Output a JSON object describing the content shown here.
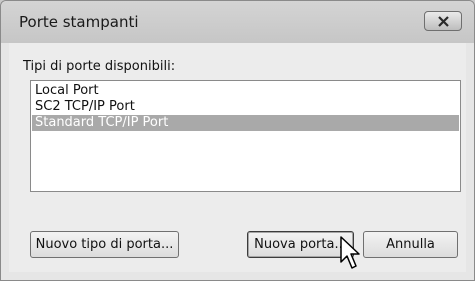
{
  "dialog": {
    "title": "Porte stampanti",
    "list_label": "Tipi di porte disponibili:",
    "port_types": [
      {
        "label": "Local Port",
        "selected": false
      },
      {
        "label": "SC2 TCP/IP Port",
        "selected": false
      },
      {
        "label": "Standard TCP/IP Port",
        "selected": true
      }
    ],
    "buttons": {
      "new_port_type": "Nuovo tipo di porta...",
      "new_port": "Nuova porta...",
      "cancel": "Annulla"
    }
  },
  "icons": {
    "close": "close-icon",
    "cursor": "mouse-pointer-icon"
  },
  "colors": {
    "selection": "#a9a9a9",
    "window_bg": "#ececec"
  }
}
